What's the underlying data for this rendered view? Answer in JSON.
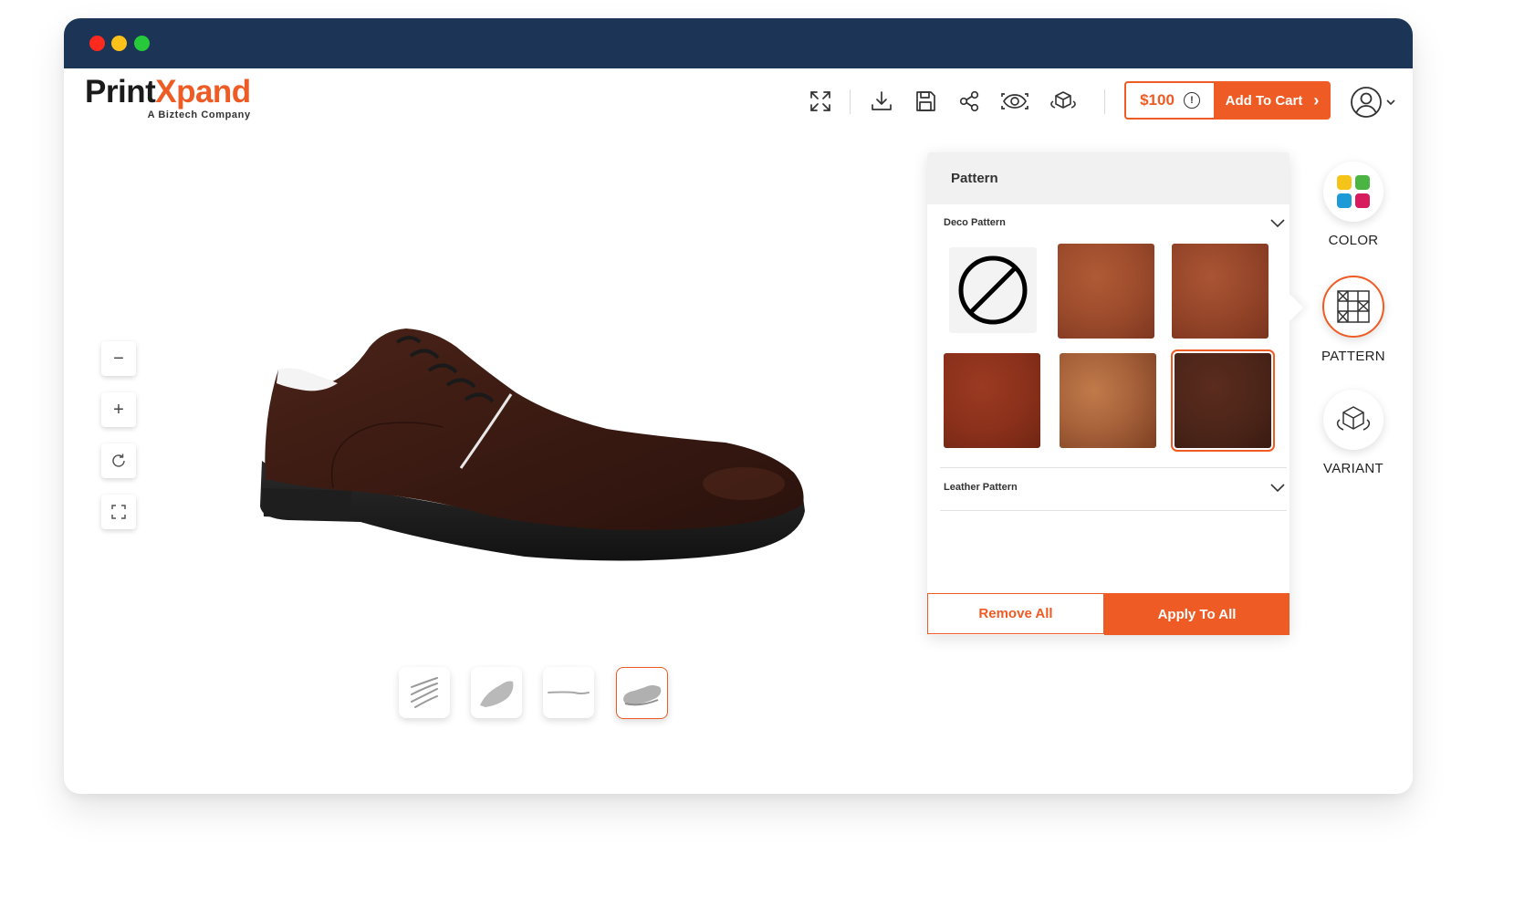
{
  "brand": {
    "name_part1": "Print",
    "name_part2": "Xpand",
    "tagline": "A Biztech Company"
  },
  "toolbar": {
    "icons": [
      "expand-icon",
      "download-icon",
      "save-icon",
      "share-icon",
      "preview-eye-icon",
      "ar-cube-icon"
    ],
    "price": "$100",
    "price_info_icon": "!",
    "add_to_cart": "Add To Cart",
    "user_icon": "user-icon"
  },
  "view_controls": [
    "zoom-out",
    "zoom-in",
    "rotate",
    "fullscreen"
  ],
  "zoom_symbols": {
    "minus": "−",
    "plus": "+"
  },
  "part_thumbnails": [
    "laces",
    "upper",
    "stitching",
    "sole"
  ],
  "pattern_panel": {
    "title": "Pattern",
    "sections": [
      {
        "label": "Deco Pattern",
        "expanded": true
      },
      {
        "label": "Leather Pattern",
        "expanded": false
      }
    ],
    "swatches": [
      {
        "type": "none"
      },
      {
        "type": "leather",
        "color": "#a0502f"
      },
      {
        "type": "leather",
        "color": "#9a4a2b"
      },
      {
        "type": "leather",
        "color": "#8f321d"
      },
      {
        "type": "leather",
        "color": "#a8633b"
      },
      {
        "type": "leather",
        "color": "#4c2519",
        "selected": true
      }
    ],
    "remove_all": "Remove All",
    "apply_to_all": "Apply To All"
  },
  "side_nav": [
    {
      "label": "COLOR",
      "icon": "color-grid-icon",
      "active": false
    },
    {
      "label": "PATTERN",
      "icon": "pattern-icon",
      "active": true
    },
    {
      "label": "VARIANT",
      "icon": "variant-cube-icon",
      "active": false
    }
  ],
  "colors": {
    "accent": "#ee5b24",
    "titlebar": "#1c3557",
    "shoe": "#3a1a12"
  }
}
